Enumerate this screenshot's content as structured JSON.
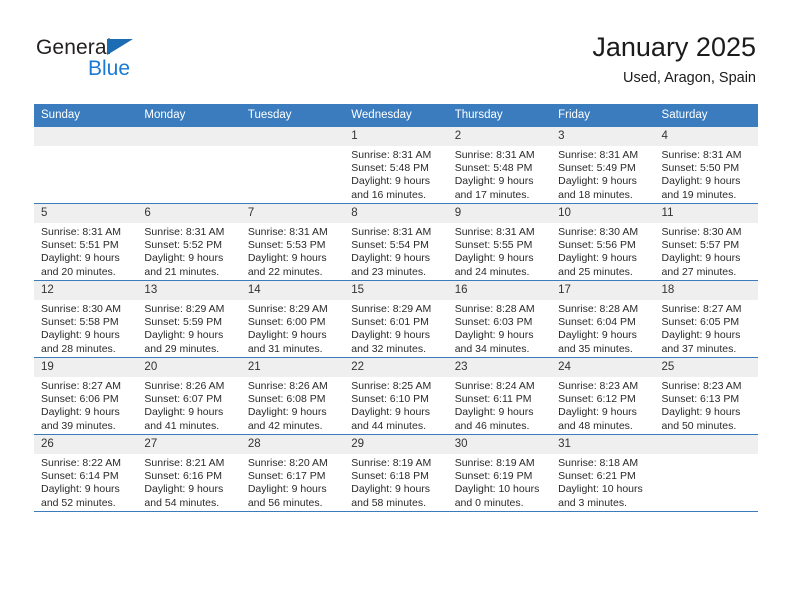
{
  "brand": {
    "name_top": "General",
    "name_bottom": "Blue",
    "accent_color": "#1b7ad1",
    "triangle_color": "#1b6cb3"
  },
  "header": {
    "title": "January 2025",
    "subtitle": "Used, Aragon, Spain"
  },
  "calendar": {
    "header_bg": "#3a7cbe",
    "daynum_bg": "#efefef",
    "weekday_headers": [
      "Sunday",
      "Monday",
      "Tuesday",
      "Wednesday",
      "Thursday",
      "Friday",
      "Saturday"
    ],
    "weeks": [
      [
        {
          "day": "",
          "lines": [],
          "blank": true
        },
        {
          "day": "",
          "lines": [],
          "blank": true
        },
        {
          "day": "",
          "lines": [],
          "blank": true
        },
        {
          "day": "1",
          "lines": [
            "Sunrise: 8:31 AM",
            "Sunset: 5:48 PM",
            "Daylight: 9 hours",
            "and 16 minutes."
          ]
        },
        {
          "day": "2",
          "lines": [
            "Sunrise: 8:31 AM",
            "Sunset: 5:48 PM",
            "Daylight: 9 hours",
            "and 17 minutes."
          ]
        },
        {
          "day": "3",
          "lines": [
            "Sunrise: 8:31 AM",
            "Sunset: 5:49 PM",
            "Daylight: 9 hours",
            "and 18 minutes."
          ]
        },
        {
          "day": "4",
          "lines": [
            "Sunrise: 8:31 AM",
            "Sunset: 5:50 PM",
            "Daylight: 9 hours",
            "and 19 minutes."
          ]
        }
      ],
      [
        {
          "day": "5",
          "lines": [
            "Sunrise: 8:31 AM",
            "Sunset: 5:51 PM",
            "Daylight: 9 hours",
            "and 20 minutes."
          ]
        },
        {
          "day": "6",
          "lines": [
            "Sunrise: 8:31 AM",
            "Sunset: 5:52 PM",
            "Daylight: 9 hours",
            "and 21 minutes."
          ]
        },
        {
          "day": "7",
          "lines": [
            "Sunrise: 8:31 AM",
            "Sunset: 5:53 PM",
            "Daylight: 9 hours",
            "and 22 minutes."
          ]
        },
        {
          "day": "8",
          "lines": [
            "Sunrise: 8:31 AM",
            "Sunset: 5:54 PM",
            "Daylight: 9 hours",
            "and 23 minutes."
          ]
        },
        {
          "day": "9",
          "lines": [
            "Sunrise: 8:31 AM",
            "Sunset: 5:55 PM",
            "Daylight: 9 hours",
            "and 24 minutes."
          ]
        },
        {
          "day": "10",
          "lines": [
            "Sunrise: 8:30 AM",
            "Sunset: 5:56 PM",
            "Daylight: 9 hours",
            "and 25 minutes."
          ]
        },
        {
          "day": "11",
          "lines": [
            "Sunrise: 8:30 AM",
            "Sunset: 5:57 PM",
            "Daylight: 9 hours",
            "and 27 minutes."
          ]
        }
      ],
      [
        {
          "day": "12",
          "lines": [
            "Sunrise: 8:30 AM",
            "Sunset: 5:58 PM",
            "Daylight: 9 hours",
            "and 28 minutes."
          ]
        },
        {
          "day": "13",
          "lines": [
            "Sunrise: 8:29 AM",
            "Sunset: 5:59 PM",
            "Daylight: 9 hours",
            "and 29 minutes."
          ]
        },
        {
          "day": "14",
          "lines": [
            "Sunrise: 8:29 AM",
            "Sunset: 6:00 PM",
            "Daylight: 9 hours",
            "and 31 minutes."
          ]
        },
        {
          "day": "15",
          "lines": [
            "Sunrise: 8:29 AM",
            "Sunset: 6:01 PM",
            "Daylight: 9 hours",
            "and 32 minutes."
          ]
        },
        {
          "day": "16",
          "lines": [
            "Sunrise: 8:28 AM",
            "Sunset: 6:03 PM",
            "Daylight: 9 hours",
            "and 34 minutes."
          ]
        },
        {
          "day": "17",
          "lines": [
            "Sunrise: 8:28 AM",
            "Sunset: 6:04 PM",
            "Daylight: 9 hours",
            "and 35 minutes."
          ]
        },
        {
          "day": "18",
          "lines": [
            "Sunrise: 8:27 AM",
            "Sunset: 6:05 PM",
            "Daylight: 9 hours",
            "and 37 minutes."
          ]
        }
      ],
      [
        {
          "day": "19",
          "lines": [
            "Sunrise: 8:27 AM",
            "Sunset: 6:06 PM",
            "Daylight: 9 hours",
            "and 39 minutes."
          ]
        },
        {
          "day": "20",
          "lines": [
            "Sunrise: 8:26 AM",
            "Sunset: 6:07 PM",
            "Daylight: 9 hours",
            "and 41 minutes."
          ]
        },
        {
          "day": "21",
          "lines": [
            "Sunrise: 8:26 AM",
            "Sunset: 6:08 PM",
            "Daylight: 9 hours",
            "and 42 minutes."
          ]
        },
        {
          "day": "22",
          "lines": [
            "Sunrise: 8:25 AM",
            "Sunset: 6:10 PM",
            "Daylight: 9 hours",
            "and 44 minutes."
          ]
        },
        {
          "day": "23",
          "lines": [
            "Sunrise: 8:24 AM",
            "Sunset: 6:11 PM",
            "Daylight: 9 hours",
            "and 46 minutes."
          ]
        },
        {
          "day": "24",
          "lines": [
            "Sunrise: 8:23 AM",
            "Sunset: 6:12 PM",
            "Daylight: 9 hours",
            "and 48 minutes."
          ]
        },
        {
          "day": "25",
          "lines": [
            "Sunrise: 8:23 AM",
            "Sunset: 6:13 PM",
            "Daylight: 9 hours",
            "and 50 minutes."
          ]
        }
      ],
      [
        {
          "day": "26",
          "lines": [
            "Sunrise: 8:22 AM",
            "Sunset: 6:14 PM",
            "Daylight: 9 hours",
            "and 52 minutes."
          ]
        },
        {
          "day": "27",
          "lines": [
            "Sunrise: 8:21 AM",
            "Sunset: 6:16 PM",
            "Daylight: 9 hours",
            "and 54 minutes."
          ]
        },
        {
          "day": "28",
          "lines": [
            "Sunrise: 8:20 AM",
            "Sunset: 6:17 PM",
            "Daylight: 9 hours",
            "and 56 minutes."
          ]
        },
        {
          "day": "29",
          "lines": [
            "Sunrise: 8:19 AM",
            "Sunset: 6:18 PM",
            "Daylight: 9 hours",
            "and 58 minutes."
          ]
        },
        {
          "day": "30",
          "lines": [
            "Sunrise: 8:19 AM",
            "Sunset: 6:19 PM",
            "Daylight: 10 hours",
            "and 0 minutes."
          ]
        },
        {
          "day": "31",
          "lines": [
            "Sunrise: 8:18 AM",
            "Sunset: 6:21 PM",
            "Daylight: 10 hours",
            "and 3 minutes."
          ]
        },
        {
          "day": "",
          "lines": [],
          "blank": true
        }
      ]
    ]
  }
}
